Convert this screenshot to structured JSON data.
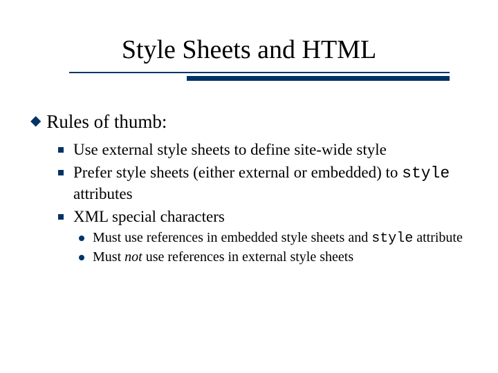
{
  "title": "Style Sheets and HTML",
  "heading": "Rules of thumb:",
  "items": [
    {
      "text": "Use external style sheets to define site-wide style"
    },
    {
      "pre": "Prefer style sheets (either external or embedded) to ",
      "code": "style",
      "post": " attributes"
    },
    {
      "text": "XML special characters",
      "sub": [
        {
          "pre": "Must use references in embedded style sheets and ",
          "code": "style",
          "post": " attribute"
        },
        {
          "pre": "Must ",
          "em": "not",
          "post": " use references in external style sheets"
        }
      ]
    }
  ]
}
